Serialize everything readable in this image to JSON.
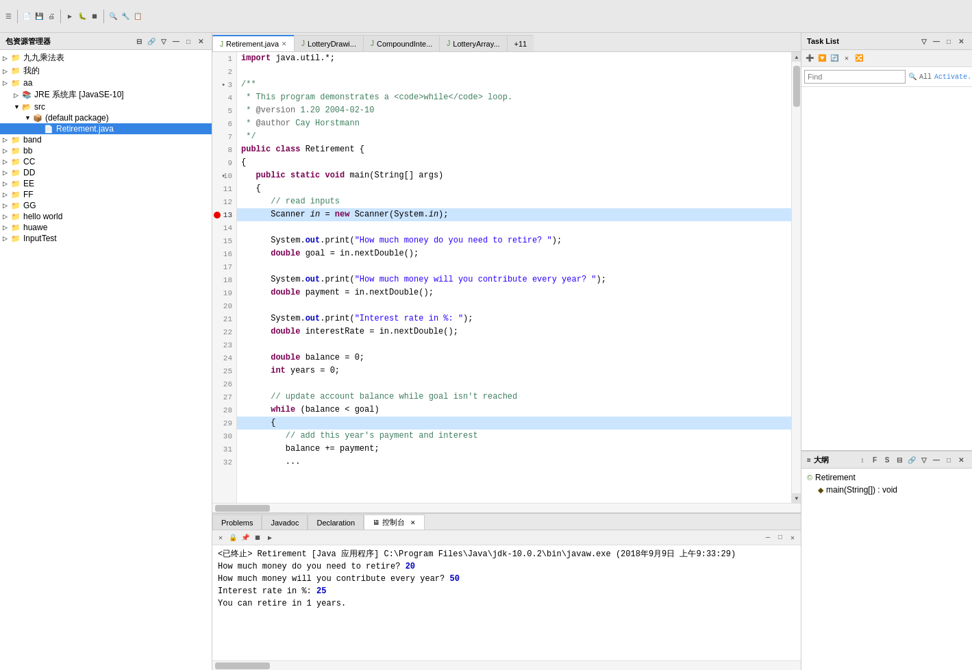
{
  "toolbar": {
    "icons": [
      "⬛",
      "💾",
      "🔍",
      "▶",
      "⏹",
      "⏸"
    ]
  },
  "left_panel": {
    "title": "包资源管理器",
    "tree": [
      {
        "id": "jiujiu",
        "label": "九九乘法表",
        "indent": 0,
        "icon": "📁",
        "arrow": "▷"
      },
      {
        "id": "wode",
        "label": "我的",
        "indent": 0,
        "icon": "📁",
        "arrow": "▷"
      },
      {
        "id": "aa",
        "label": "aa",
        "indent": 0,
        "icon": "📁",
        "arrow": "▷"
      },
      {
        "id": "jre",
        "label": "JRE 系统库 [JavaSE-10]",
        "indent": 1,
        "icon": "📚",
        "arrow": "▷"
      },
      {
        "id": "src",
        "label": "src",
        "indent": 1,
        "icon": "📂",
        "arrow": "▼"
      },
      {
        "id": "default-pkg",
        "label": "(default package)",
        "indent": 2,
        "icon": "📦",
        "arrow": "▼"
      },
      {
        "id": "retirement-java",
        "label": "Retirement.java",
        "indent": 3,
        "icon": "📄",
        "selected": true
      },
      {
        "id": "band",
        "label": "band",
        "indent": 0,
        "icon": "📁",
        "arrow": "▷"
      },
      {
        "id": "bb",
        "label": "bb",
        "indent": 0,
        "icon": "📁",
        "arrow": "▷"
      },
      {
        "id": "CC",
        "label": "CC",
        "indent": 0,
        "icon": "📁",
        "arrow": "▷"
      },
      {
        "id": "DD",
        "label": "DD",
        "indent": 0,
        "icon": "📁",
        "arrow": "▷"
      },
      {
        "id": "EE",
        "label": "EE",
        "indent": 0,
        "icon": "📁",
        "arrow": "▷"
      },
      {
        "id": "FF",
        "label": "FF",
        "indent": 0,
        "icon": "📁",
        "arrow": "▷"
      },
      {
        "id": "GG",
        "label": "GG",
        "indent": 0,
        "icon": "📁",
        "arrow": "▷"
      },
      {
        "id": "hello-world",
        "label": "hello world",
        "indent": 0,
        "icon": "📁",
        "arrow": "▷"
      },
      {
        "id": "huawe",
        "label": "huawe",
        "indent": 0,
        "icon": "📁",
        "arrow": "▷"
      },
      {
        "id": "InputTest",
        "label": "InputTest",
        "indent": 0,
        "icon": "📁",
        "arrow": "▷"
      }
    ]
  },
  "editor": {
    "tabs": [
      {
        "label": "Retirement.java",
        "active": true,
        "icon": "J"
      },
      {
        "label": "LotteryDrawi...",
        "active": false,
        "icon": "J"
      },
      {
        "label": "CompoundInte...",
        "active": false,
        "icon": "J"
      },
      {
        "label": "LotteryArray...",
        "active": false,
        "icon": "J"
      },
      {
        "label": "+11",
        "active": false,
        "icon": ""
      }
    ],
    "lines": [
      {
        "num": 1,
        "content": "import java.util.*;",
        "tokens": [
          {
            "text": "import ",
            "cls": "kw"
          },
          {
            "text": "java.util.*;"
          }
        ]
      },
      {
        "num": 2,
        "content": "",
        "tokens": []
      },
      {
        "num": 3,
        "content": "/**",
        "tokens": [
          {
            "text": "/**",
            "cls": "comment"
          }
        ],
        "arrow": true
      },
      {
        "num": 4,
        "content": " * This program demonstrates a <code>while</code> loop.",
        "tokens": [
          {
            "text": " * This program demonstrates a ",
            "cls": "comment"
          },
          {
            "text": "<code>",
            "cls": "comment"
          },
          {
            "text": "while",
            "cls": "comment"
          },
          {
            "text": "</code>",
            "cls": "comment"
          },
          {
            "text": " loop.",
            "cls": "comment"
          }
        ]
      },
      {
        "num": 5,
        "content": " * @version 1.20 2004-02-10",
        "tokens": [
          {
            "text": " * ",
            "cls": "comment"
          },
          {
            "text": "@version",
            "cls": "annotation"
          },
          {
            "text": " 1.20 2004-02-10",
            "cls": "comment"
          }
        ]
      },
      {
        "num": 6,
        "content": " * @author Cay Horstmann",
        "tokens": [
          {
            "text": " * ",
            "cls": "comment"
          },
          {
            "text": "@author",
            "cls": "annotation"
          },
          {
            "text": " Cay Horstmann",
            "cls": "comment"
          }
        ]
      },
      {
        "num": 7,
        "content": " */",
        "tokens": [
          {
            "text": " */",
            "cls": "comment"
          }
        ]
      },
      {
        "num": 8,
        "content": "public class Retirement {",
        "tokens": [
          {
            "text": "public ",
            "cls": "kw"
          },
          {
            "text": "class ",
            "cls": "kw"
          },
          {
            "text": "Retirement {"
          }
        ]
      },
      {
        "num": 9,
        "content": "{",
        "tokens": [
          {
            "text": "{"
          }
        ]
      },
      {
        "num": 10,
        "content": "   public static void main(String[] args)",
        "tokens": [
          {
            "text": "   "
          },
          {
            "text": "public ",
            "cls": "kw"
          },
          {
            "text": "static ",
            "cls": "kw"
          },
          {
            "text": "void ",
            "cls": "kw"
          },
          {
            "text": "main(String[] args)"
          }
        ],
        "arrow": true
      },
      {
        "num": 11,
        "content": "   {",
        "tokens": [
          {
            "text": "   {"
          }
        ]
      },
      {
        "num": 12,
        "content": "      // read inputs",
        "tokens": [
          {
            "text": "      // read inputs",
            "cls": "comment"
          }
        ]
      },
      {
        "num": 13,
        "content": "      Scanner in = new Scanner(System.in);",
        "tokens": [
          {
            "text": "      Scanner "
          },
          {
            "text": "in",
            "cls": "italic"
          },
          {
            "text": " = "
          },
          {
            "text": "new ",
            "cls": "kw"
          },
          {
            "text": "Scanner(System."
          },
          {
            "text": "in",
            "cls": "italic"
          },
          {
            "text": ");"
          }
        ],
        "breakpoint": true,
        "highlighted": true
      },
      {
        "num": 14,
        "content": "",
        "tokens": []
      },
      {
        "num": 15,
        "content": "      System.out.print(\"How much money do you need to retire? \");",
        "tokens": [
          {
            "text": "      System."
          },
          {
            "text": "out",
            "cls": "kw2"
          },
          {
            "text": ".print("
          },
          {
            "text": "\"How much money do you need to retire? \"",
            "cls": "string"
          },
          {
            "text": ");"
          }
        ]
      },
      {
        "num": 16,
        "content": "      double goal = in.nextDouble();",
        "tokens": [
          {
            "text": "      "
          },
          {
            "text": "double ",
            "cls": "kw"
          },
          {
            "text": "goal = in.nextDouble();"
          }
        ]
      },
      {
        "num": 17,
        "content": "",
        "tokens": []
      },
      {
        "num": 18,
        "content": "      System.out.print(\"How much money will you contribute every year? \");",
        "tokens": [
          {
            "text": "      System."
          },
          {
            "text": "out",
            "cls": "kw2"
          },
          {
            "text": ".print("
          },
          {
            "text": "\"How much money will you contribute every year? \"",
            "cls": "string"
          },
          {
            "text": ");"
          }
        ]
      },
      {
        "num": 19,
        "content": "      double payment = in.nextDouble();",
        "tokens": [
          {
            "text": "      "
          },
          {
            "text": "double ",
            "cls": "kw"
          },
          {
            "text": "payment = in.nextDouble();"
          }
        ]
      },
      {
        "num": 20,
        "content": "",
        "tokens": []
      },
      {
        "num": 21,
        "content": "      System.out.print(\"Interest rate in %: \");",
        "tokens": [
          {
            "text": "      System."
          },
          {
            "text": "out",
            "cls": "kw2"
          },
          {
            "text": ".print("
          },
          {
            "text": "\"Interest rate in %: \"",
            "cls": "string"
          },
          {
            "text": ");"
          }
        ]
      },
      {
        "num": 22,
        "content": "      double interestRate = in.nextDouble();",
        "tokens": [
          {
            "text": "      "
          },
          {
            "text": "double ",
            "cls": "kw"
          },
          {
            "text": "interestRate = in.nextDouble();"
          }
        ]
      },
      {
        "num": 23,
        "content": "",
        "tokens": []
      },
      {
        "num": 24,
        "content": "      double balance = 0;",
        "tokens": [
          {
            "text": "      "
          },
          {
            "text": "double ",
            "cls": "kw"
          },
          {
            "text": "balance = 0;"
          }
        ]
      },
      {
        "num": 25,
        "content": "      int years = 0;",
        "tokens": [
          {
            "text": "      "
          },
          {
            "text": "int ",
            "cls": "kw"
          },
          {
            "text": "years = 0;"
          }
        ]
      },
      {
        "num": 26,
        "content": "",
        "tokens": []
      },
      {
        "num": 27,
        "content": "      // update account balance while goal isn't reached",
        "tokens": [
          {
            "text": "      // update account balance while goal isn't reached",
            "cls": "comment"
          }
        ]
      },
      {
        "num": 28,
        "content": "      while (balance < goal)",
        "tokens": [
          {
            "text": "      "
          },
          {
            "text": "while ",
            "cls": "kw"
          },
          {
            "text": "(balance < goal)"
          }
        ]
      },
      {
        "num": 29,
        "content": "      {",
        "tokens": [
          {
            "text": "      {"
          }
        ],
        "highlighted": true
      },
      {
        "num": 30,
        "content": "         // add this year's payment and interest",
        "tokens": [
          {
            "text": "         // add this year's payment and interest",
            "cls": "comment"
          }
        ]
      },
      {
        "num": 31,
        "content": "         balance += payment;",
        "tokens": [
          {
            "text": "         balance += payment;"
          }
        ]
      },
      {
        "num": 32,
        "content": "         ...",
        "tokens": [
          {
            "text": "         ..."
          }
        ]
      }
    ]
  },
  "task_list": {
    "title": "Task List",
    "find_placeholder": "Find",
    "buttons": [
      "All",
      "Activate..."
    ]
  },
  "outline": {
    "title": "大纲",
    "items": [
      {
        "label": "Retirement",
        "icon": "class",
        "indent": 0
      },
      {
        "label": "main(String[]) : void",
        "icon": "method",
        "indent": 1
      }
    ]
  },
  "bottom_panel": {
    "tabs": [
      "Problems",
      "Javadoc",
      "Declaration",
      "控制台"
    ],
    "active_tab": "控制台",
    "console_lines": [
      {
        "text": "<已终止> Retirement [Java 应用程序] C:\\Program Files\\Java\\jdk-10.0.2\\bin\\javaw.exe  (2018年9月9日 上午9:33:29)"
      },
      {
        "text": "How much money do you need to retire? ",
        "highlight": "20",
        "highlight_val": "20"
      },
      {
        "text": "How much money will you contribute every year? ",
        "highlight": "50",
        "highlight_val": "50"
      },
      {
        "text": "Interest rate in %: ",
        "highlight": "25",
        "highlight_val": "25"
      },
      {
        "text": "You can retire in 1 years."
      }
    ]
  }
}
